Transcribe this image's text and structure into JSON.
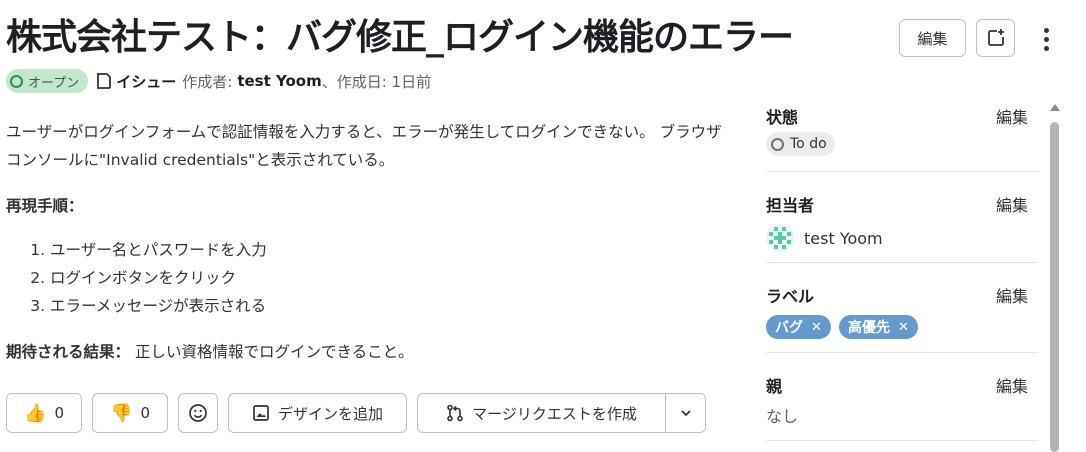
{
  "header": {
    "title": "株式会社テスト：バグ修正_ログイン機能のエラー",
    "edit_label": "編集",
    "new_issue_icon": "new-issue-icon",
    "more_icon": "kebab-icon"
  },
  "meta": {
    "status": "オープン",
    "type": "イシュー",
    "author_prefix": "作成者:",
    "author": "test Yoom",
    "created": "、作成日: 1日前"
  },
  "description": {
    "paragraph": "ユーザーがログインフォームで認証情報を入力すると、エラーが発生してログインできない。 ブラウザコンソールに\"Invalid credentials\"と表示されている。",
    "steps_heading": "再現手順：",
    "steps": [
      "ユーザー名とパスワードを入力",
      "ログインボタンをクリック",
      "エラーメッセージが表示される"
    ],
    "expected_label": "期待される結果：",
    "expected_text": " 正しい資格情報でログインできること。"
  },
  "actions": {
    "thumbs_up_count": "0",
    "thumbs_down_count": "0",
    "add_design": "デザインを追加",
    "create_mr": "マージリクエストを作成"
  },
  "sidebar": {
    "status": {
      "label": "状態",
      "edit": "編集",
      "value": "To do"
    },
    "assignee": {
      "label": "担当者",
      "edit": "編集",
      "name": "test Yoom"
    },
    "labels": {
      "label": "ラベル",
      "edit": "編集",
      "items": [
        "バグ",
        "高優先"
      ],
      "color": "#6699cc"
    },
    "parent": {
      "label": "親",
      "edit": "編集",
      "value": "なし"
    }
  }
}
